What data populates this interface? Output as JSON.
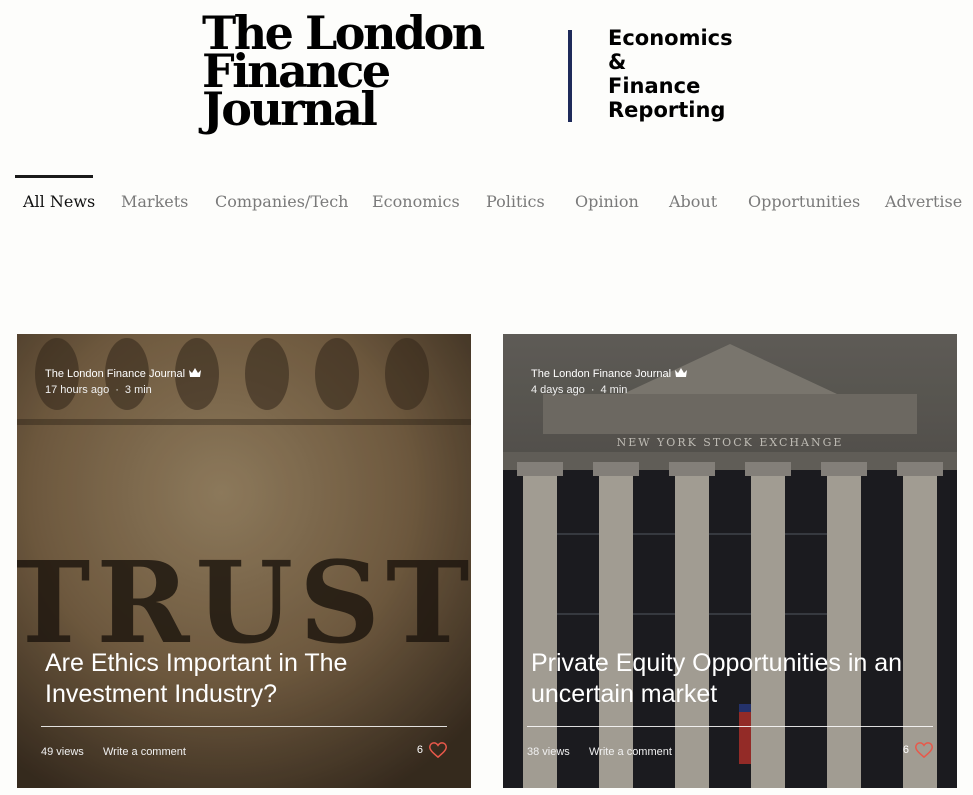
{
  "header": {
    "logo_lines": [
      "The London",
      "Finance",
      "Journal"
    ],
    "tagline_lines": [
      "Economics",
      "&",
      "Finance",
      "Reporting"
    ],
    "rule_color": "#1e2a5a"
  },
  "nav": {
    "items": [
      {
        "label": "All News",
        "active": true
      },
      {
        "label": "Markets",
        "active": false
      },
      {
        "label": "Companies/Tech",
        "active": false
      },
      {
        "label": "Economics",
        "active": false
      },
      {
        "label": "Politics",
        "active": false
      },
      {
        "label": "Opinion",
        "active": false
      },
      {
        "label": "About",
        "active": false
      },
      {
        "label": "Opportunities",
        "active": false
      },
      {
        "label": "Advertise",
        "active": false
      }
    ]
  },
  "posts": [
    {
      "author": "The London Finance Journal",
      "time_ago": "17 hours ago",
      "read_time": "3 min",
      "title": "Are Ethics Important in The Investment Industry?",
      "views": "49 views",
      "comment_label": "Write a comment",
      "likes": "6",
      "image_caption": "TRUST"
    },
    {
      "author": "The London Finance Journal",
      "time_ago": "4 days ago",
      "read_time": "4 min",
      "title": "Private Equity Opportunities in an uncertain market",
      "views": "38 views",
      "comment_label": "Write a comment",
      "likes": "6",
      "image_caption": "NEW YORK STOCK EXCHANGE"
    }
  ],
  "colors": {
    "heart": "#e8584a",
    "nav_active": "#111111",
    "nav_inactive": "#7a7a7a"
  },
  "icons": {
    "author_badge": "crown-icon",
    "like": "heart-icon"
  }
}
